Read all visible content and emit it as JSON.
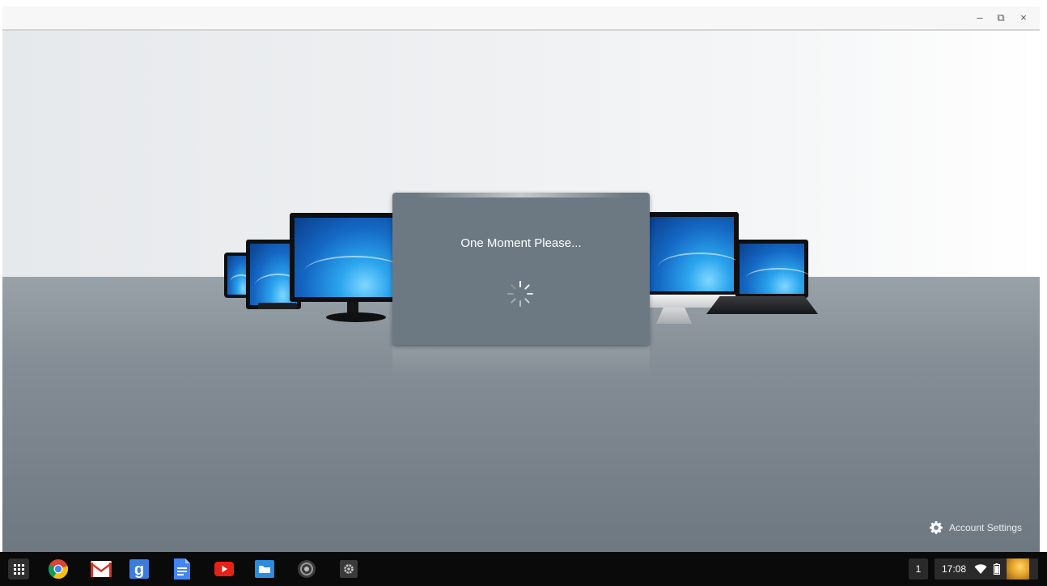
{
  "window": {
    "controls": {
      "minimize": "–",
      "restore": "⧉",
      "close": "×"
    }
  },
  "dialog": {
    "message": "One Moment Please..."
  },
  "footer": {
    "account_settings_label": "Account Settings"
  },
  "taskbar": {
    "apps": [
      {
        "icon": "app-launcher-icon"
      },
      {
        "icon": "chrome-icon"
      },
      {
        "icon": "gmail-icon"
      },
      {
        "icon": "google-search-icon"
      },
      {
        "icon": "docs-icon"
      },
      {
        "icon": "youtube-icon"
      },
      {
        "icon": "files-icon"
      },
      {
        "icon": "remote-desktop-icon"
      },
      {
        "icon": "settings-app-icon"
      }
    ],
    "workspace": "1",
    "clock": "17:08"
  },
  "colors": {
    "dialog_bg": "#6d7982",
    "taskbar_bg": "#0a0a0a",
    "floor": "#858e96"
  }
}
